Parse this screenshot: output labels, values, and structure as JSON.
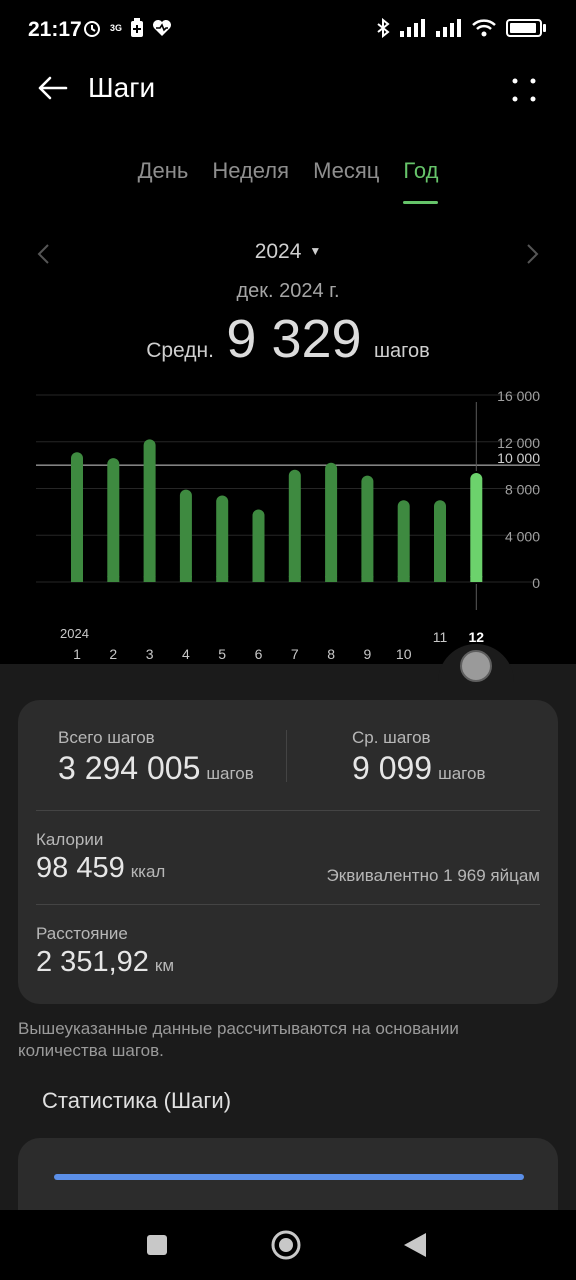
{
  "status": {
    "time": "21:17",
    "network_badge": "3G",
    "icons": [
      "alarm-icon",
      "battery-saver-icon",
      "health-icon",
      "bluetooth-icon",
      "signal-icon",
      "signal-icon",
      "wifi-icon",
      "battery-icon"
    ]
  },
  "header": {
    "title": "Шаги"
  },
  "tabs": [
    {
      "label": "День",
      "active": false
    },
    {
      "label": "Неделя",
      "active": false
    },
    {
      "label": "Месяц",
      "active": false
    },
    {
      "label": "Год",
      "active": true
    }
  ],
  "year_nav": {
    "year": "2024"
  },
  "summary_top": {
    "period": "дек. 2024 г.",
    "avg_prefix": "Средн.",
    "avg_value": "9 329",
    "avg_unit": "шагов"
  },
  "chart_data": {
    "type": "bar",
    "year_label": "2024",
    "categories": [
      "1",
      "2",
      "3",
      "4",
      "5",
      "6",
      "7",
      "8",
      "9",
      "10",
      "11",
      "12"
    ],
    "values": [
      11100,
      10600,
      12200,
      7900,
      7400,
      6200,
      9600,
      10200,
      9100,
      7000,
      7000,
      9329
    ],
    "selected_index": 11,
    "goal": 10000,
    "goal_label": "10 000",
    "ylim": [
      0,
      16000
    ],
    "yticks": [
      {
        "value": 0,
        "label": "0"
      },
      {
        "value": 4000,
        "label": "4 000"
      },
      {
        "value": 8000,
        "label": "8 000"
      },
      {
        "value": 12000,
        "label": "12 000"
      },
      {
        "value": 16000,
        "label": "16 000"
      }
    ],
    "colors": {
      "bar": "#3e8a40",
      "selected": "#6cd26c",
      "goal": "#cfcfcf",
      "grid": "#262626",
      "label": "#a0a0a0"
    }
  },
  "card": {
    "total_steps": {
      "label": "Всего шагов",
      "value": "3 294 005",
      "unit": "шагов"
    },
    "avg_steps": {
      "label": "Ср. шагов",
      "value": "9 099",
      "unit": "шагов"
    },
    "calories": {
      "label": "Калории",
      "value": "98 459",
      "unit": "ккал",
      "equivalent": "Эквивалентно 1 969 яйцам"
    },
    "distance": {
      "label": "Расстояние",
      "value": "2 351,92",
      "unit": "км"
    }
  },
  "footnote": "Вышеуказанные данные рассчитываются на основании количества шагов.",
  "statistics": {
    "title": "Статистика (Шаги)"
  },
  "colors": {
    "accent": "#66c46a",
    "stats_bar": "#5b8fe8"
  }
}
